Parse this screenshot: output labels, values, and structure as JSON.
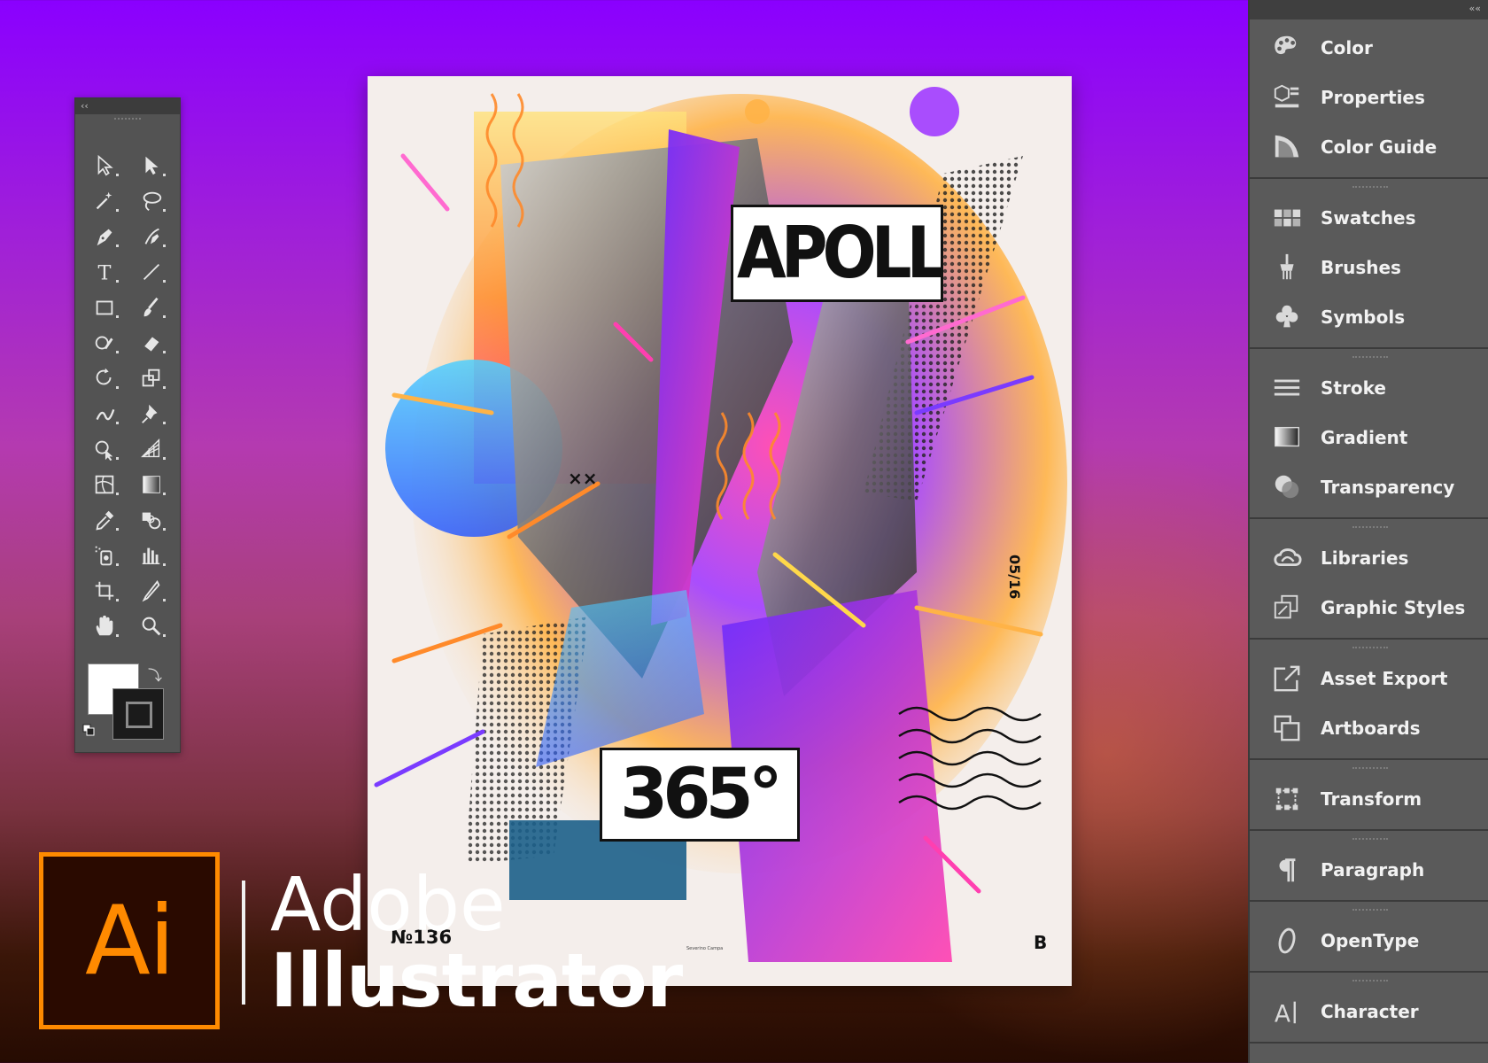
{
  "colors": {
    "accent": "#ff8a00",
    "panel_bg": "#535353",
    "dock_bg": "#5a5a5a"
  },
  "tools_panel": {
    "collapse_label": "‹‹",
    "tools": [
      {
        "name": "selection-tool",
        "icon": "selection-arrow-icon"
      },
      {
        "name": "direct-selection-tool",
        "icon": "direct-selection-arrow-icon"
      },
      {
        "name": "magic-wand-tool",
        "icon": "magic-wand-icon"
      },
      {
        "name": "lasso-tool",
        "icon": "lasso-icon"
      },
      {
        "name": "pen-tool",
        "icon": "pen-icon"
      },
      {
        "name": "curvature-tool",
        "icon": "curvature-pen-icon"
      },
      {
        "name": "type-tool",
        "icon": "type-T-icon"
      },
      {
        "name": "line-segment-tool",
        "icon": "line-icon"
      },
      {
        "name": "rectangle-tool",
        "icon": "rectangle-icon"
      },
      {
        "name": "paintbrush-tool",
        "icon": "paintbrush-icon"
      },
      {
        "name": "shaper-tool",
        "icon": "shaper-icon"
      },
      {
        "name": "eraser-tool",
        "icon": "eraser-icon"
      },
      {
        "name": "rotate-tool",
        "icon": "rotate-icon"
      },
      {
        "name": "scale-tool",
        "icon": "scale-icon"
      },
      {
        "name": "warp-tool",
        "icon": "warp-icon"
      },
      {
        "name": "puppet-warp-tool",
        "icon": "pin-icon"
      },
      {
        "name": "shape-builder-tool",
        "icon": "shape-builder-icon"
      },
      {
        "name": "perspective-grid-tool",
        "icon": "perspective-grid-icon"
      },
      {
        "name": "mesh-tool",
        "icon": "mesh-icon"
      },
      {
        "name": "gradient-tool",
        "icon": "gradient-icon"
      },
      {
        "name": "eyedropper-tool",
        "icon": "eyedropper-icon"
      },
      {
        "name": "blend-tool",
        "icon": "blend-icon"
      },
      {
        "name": "symbol-sprayer-tool",
        "icon": "symbol-sprayer-icon"
      },
      {
        "name": "column-graph-tool",
        "icon": "column-graph-icon"
      },
      {
        "name": "artboard-tool",
        "icon": "artboard-crop-icon"
      },
      {
        "name": "slice-tool",
        "icon": "slice-knife-icon"
      },
      {
        "name": "hand-tool",
        "icon": "hand-icon"
      },
      {
        "name": "zoom-tool",
        "icon": "zoom-magnifier-icon"
      }
    ]
  },
  "artwork": {
    "title": "APOLLO",
    "number": "365°",
    "issue": "№136",
    "date": "05/16",
    "credit": "Severino Campa",
    "brand": "B",
    "x_marks": "××"
  },
  "dock": {
    "collapse_label": "««",
    "groups": [
      {
        "items": [
          {
            "label": "Color",
            "icon": "palette-icon"
          },
          {
            "label": "Properties",
            "icon": "properties-icon"
          },
          {
            "label": "Color Guide",
            "icon": "color-guide-icon"
          }
        ]
      },
      {
        "items": [
          {
            "label": "Swatches",
            "icon": "swatches-icon"
          },
          {
            "label": "Brushes",
            "icon": "brushes-icon"
          },
          {
            "label": "Symbols",
            "icon": "club-symbol-icon"
          }
        ]
      },
      {
        "items": [
          {
            "label": "Stroke",
            "icon": "stroke-lines-icon"
          },
          {
            "label": "Gradient",
            "icon": "gradient-square-icon"
          },
          {
            "label": "Transparency",
            "icon": "transparency-circles-icon"
          }
        ]
      },
      {
        "items": [
          {
            "label": "Libraries",
            "icon": "creative-cloud-icon"
          },
          {
            "label": "Graphic Styles",
            "icon": "graphic-styles-icon"
          }
        ]
      },
      {
        "items": [
          {
            "label": "Asset Export",
            "icon": "export-icon"
          },
          {
            "label": "Artboards",
            "icon": "artboards-icon"
          }
        ]
      },
      {
        "items": [
          {
            "label": "Transform",
            "icon": "transform-icon"
          }
        ]
      },
      {
        "items": [
          {
            "label": "Paragraph",
            "icon": "pilcrow-icon"
          }
        ]
      },
      {
        "items": [
          {
            "label": "OpenType",
            "icon": "opentype-icon"
          }
        ]
      },
      {
        "items": [
          {
            "label": "Character",
            "icon": "character-icon"
          }
        ]
      }
    ]
  },
  "branding": {
    "logo_text": "Ai",
    "line1": "Adobe",
    "line2": "Illustrator"
  }
}
